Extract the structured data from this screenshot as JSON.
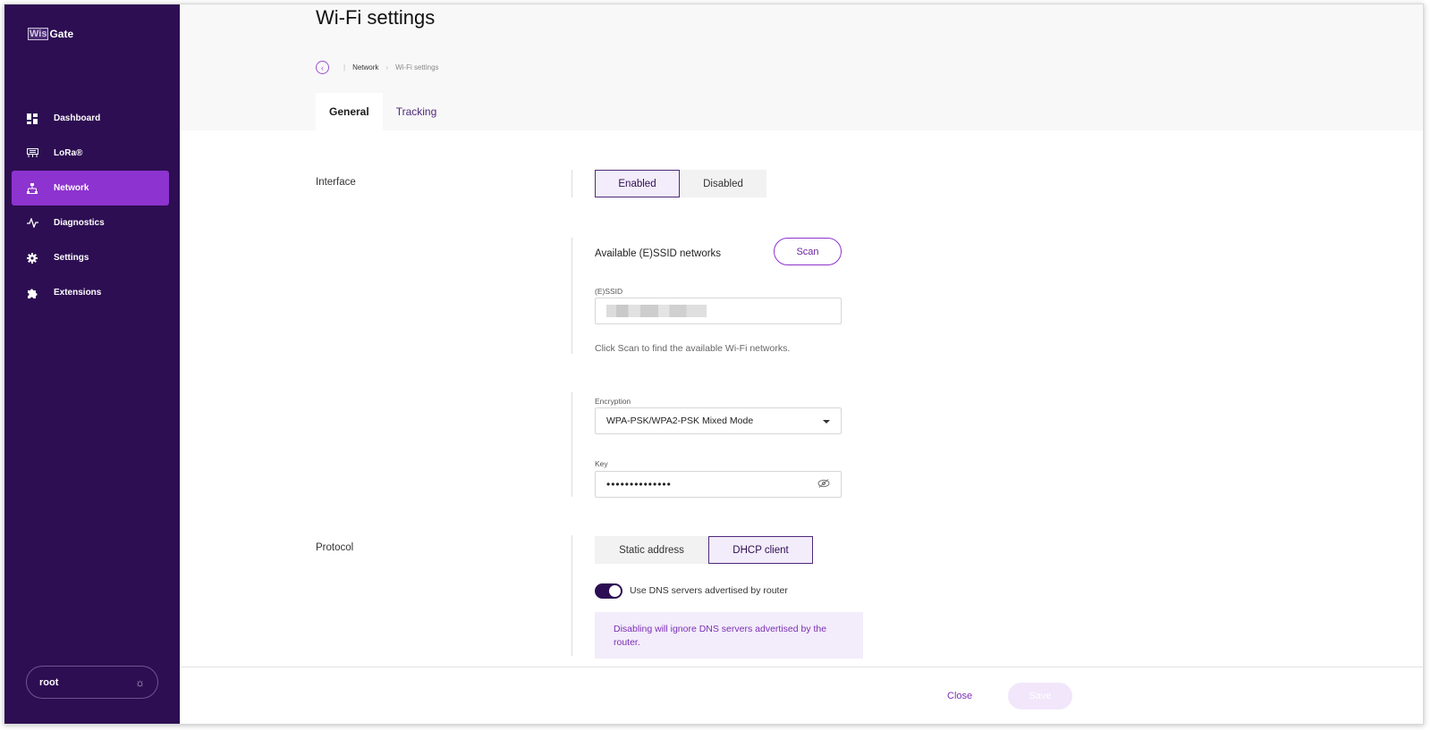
{
  "app": {
    "logo_box": "Wis",
    "logo_text": "Gate"
  },
  "sidebar": {
    "items": [
      {
        "label": "Dashboard",
        "icon": "dashboard-icon"
      },
      {
        "label": "LoRa®",
        "icon": "lora-icon"
      },
      {
        "label": "Network",
        "icon": "network-icon",
        "active": true
      },
      {
        "label": "Diagnostics",
        "icon": "diagnostics-icon"
      },
      {
        "label": "Settings",
        "icon": "gear-icon"
      },
      {
        "label": "Extensions",
        "icon": "puzzle-icon"
      }
    ],
    "user": "root",
    "theme_icon": "sun-icon"
  },
  "header": {
    "title": "Wi-Fi settings",
    "breadcrumb": [
      "Network",
      "Wi-Fi settings"
    ],
    "tabs": [
      {
        "label": "General",
        "active": true
      },
      {
        "label": "Tracking",
        "active": false
      }
    ]
  },
  "form": {
    "interface": {
      "label": "Interface",
      "options": [
        "Enabled",
        "Disabled"
      ],
      "selected": "Enabled"
    },
    "essid": {
      "section_title": "Available (E)SSID networks",
      "scan_label": "Scan",
      "field_label": "(E)SSID",
      "hint": "Click Scan to find the available Wi-Fi networks."
    },
    "encryption": {
      "field_label": "Encryption",
      "value": "WPA-PSK/WPA2-PSK Mixed Mode"
    },
    "key": {
      "field_label": "Key",
      "value": "••••••••••••••"
    },
    "protocol": {
      "label": "Protocol",
      "options": [
        "Static address",
        "DHCP client"
      ],
      "selected": "DHCP client",
      "dns_toggle_label": "Use DNS servers advertised by router",
      "dns_toggle_on": true,
      "info": "Disabling will ignore DNS servers advertised by the router."
    }
  },
  "footer": {
    "close_label": "Close",
    "save_label": "Save"
  },
  "colors": {
    "sidebar_bg": "#2d0e52",
    "accent": "#8d33cf"
  }
}
